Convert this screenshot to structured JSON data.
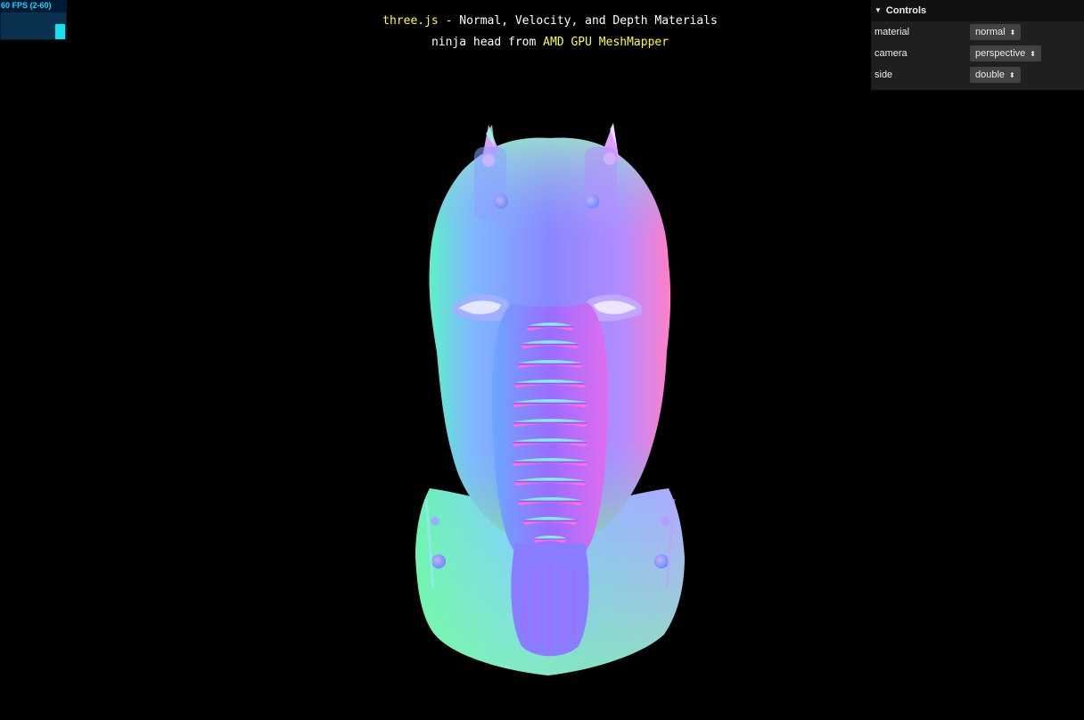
{
  "stats": {
    "fps_text": "60 FPS (2-60)",
    "bar_color": "#16e1f0"
  },
  "info": {
    "line1_link": "three.js",
    "line1_text": " - Normal, Velocity, and Depth Materials",
    "line2_text": "ninja head from ",
    "line2_link": "AMD GPU MeshMapper",
    "link_color": "#ffff33"
  },
  "controls": {
    "title": "Controls",
    "rows": [
      {
        "label": "material",
        "value": "normal"
      },
      {
        "label": "camera",
        "value": "perspective"
      },
      {
        "label": "side",
        "value": "double"
      }
    ]
  },
  "scene": {
    "model": "ninja-head-normal-material",
    "background": "#000000"
  }
}
